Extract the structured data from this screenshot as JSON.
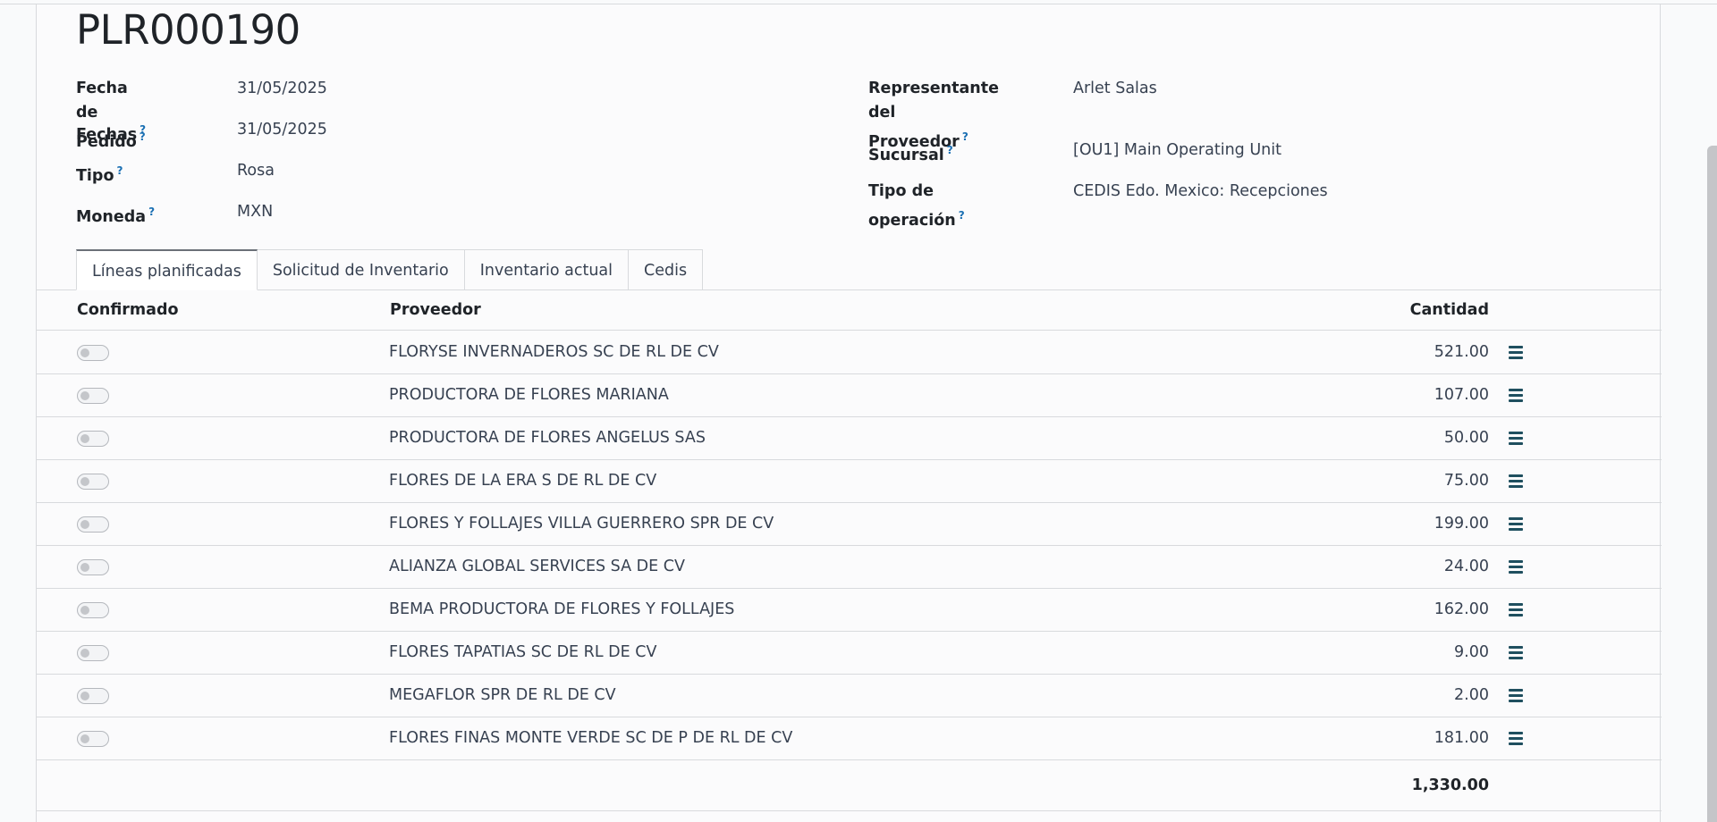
{
  "record": {
    "title": "PLR000190"
  },
  "fields_left": [
    {
      "label": "Fecha de Pedido",
      "help": "?",
      "value": "31/05/2025"
    },
    {
      "label": "Fechas",
      "help": "?",
      "value": "31/05/2025"
    },
    {
      "label": "Tipo",
      "help": "?",
      "value": "Rosa"
    },
    {
      "label": "Moneda",
      "help": "?",
      "value": "MXN"
    }
  ],
  "fields_right": [
    {
      "label_line1": "Representante del",
      "label_line2": "Proveedor",
      "help": "?",
      "value": "Arlet Salas"
    },
    {
      "label": "Sucursal",
      "help": "?",
      "value": "[OU1] Main Operating Unit"
    },
    {
      "label": "Tipo de operación",
      "help": "?",
      "value": "CEDIS Edo. Mexico: Recepciones"
    }
  ],
  "tabs": [
    {
      "label": "Líneas planificadas",
      "active": true
    },
    {
      "label": "Solicitud de Inventario",
      "active": false
    },
    {
      "label": "Inventario actual",
      "active": false
    },
    {
      "label": "Cedis",
      "active": false
    }
  ],
  "table": {
    "headers": {
      "confirmado": "Confirmado",
      "proveedor": "Proveedor",
      "cantidad": "Cantidad"
    },
    "rows": [
      {
        "confirmado": false,
        "proveedor": "FLORYSE INVERNADEROS SC DE RL DE CV",
        "cantidad": "521.00"
      },
      {
        "confirmado": false,
        "proveedor": "PRODUCTORA DE FLORES MARIANA",
        "cantidad": "107.00"
      },
      {
        "confirmado": false,
        "proveedor": "PRODUCTORA DE FLORES ANGELUS SAS",
        "cantidad": "50.00"
      },
      {
        "confirmado": false,
        "proveedor": "FLORES DE LA ERA S DE RL DE CV",
        "cantidad": "75.00"
      },
      {
        "confirmado": false,
        "proveedor": "FLORES Y FOLLAJES VILLA GUERRERO SPR DE CV",
        "cantidad": "199.00"
      },
      {
        "confirmado": false,
        "proveedor": "ALIANZA GLOBAL SERVICES SA DE CV",
        "cantidad": "24.00"
      },
      {
        "confirmado": false,
        "proveedor": "BEMA PRODUCTORA DE FLORES Y FOLLAJES",
        "cantidad": "162.00"
      },
      {
        "confirmado": false,
        "proveedor": "FLORES TAPATIAS SC DE RL DE CV",
        "cantidad": "9.00"
      },
      {
        "confirmado": false,
        "proveedor": "MEGAFLOR SPR DE RL DE CV",
        "cantidad": "2.00"
      },
      {
        "confirmado": false,
        "proveedor": "FLORES FINAS MONTE VERDE SC DE P DE RL DE CV",
        "cantidad": "181.00"
      }
    ],
    "total_cantidad": "1,330.00"
  },
  "icons": {
    "row_handle": "hamburger-menu-icon",
    "help": "question-mark-tooltip-icon"
  },
  "colors": {
    "help_accent": "#1a6fb3",
    "handle_icon": "#1f4f5f"
  }
}
